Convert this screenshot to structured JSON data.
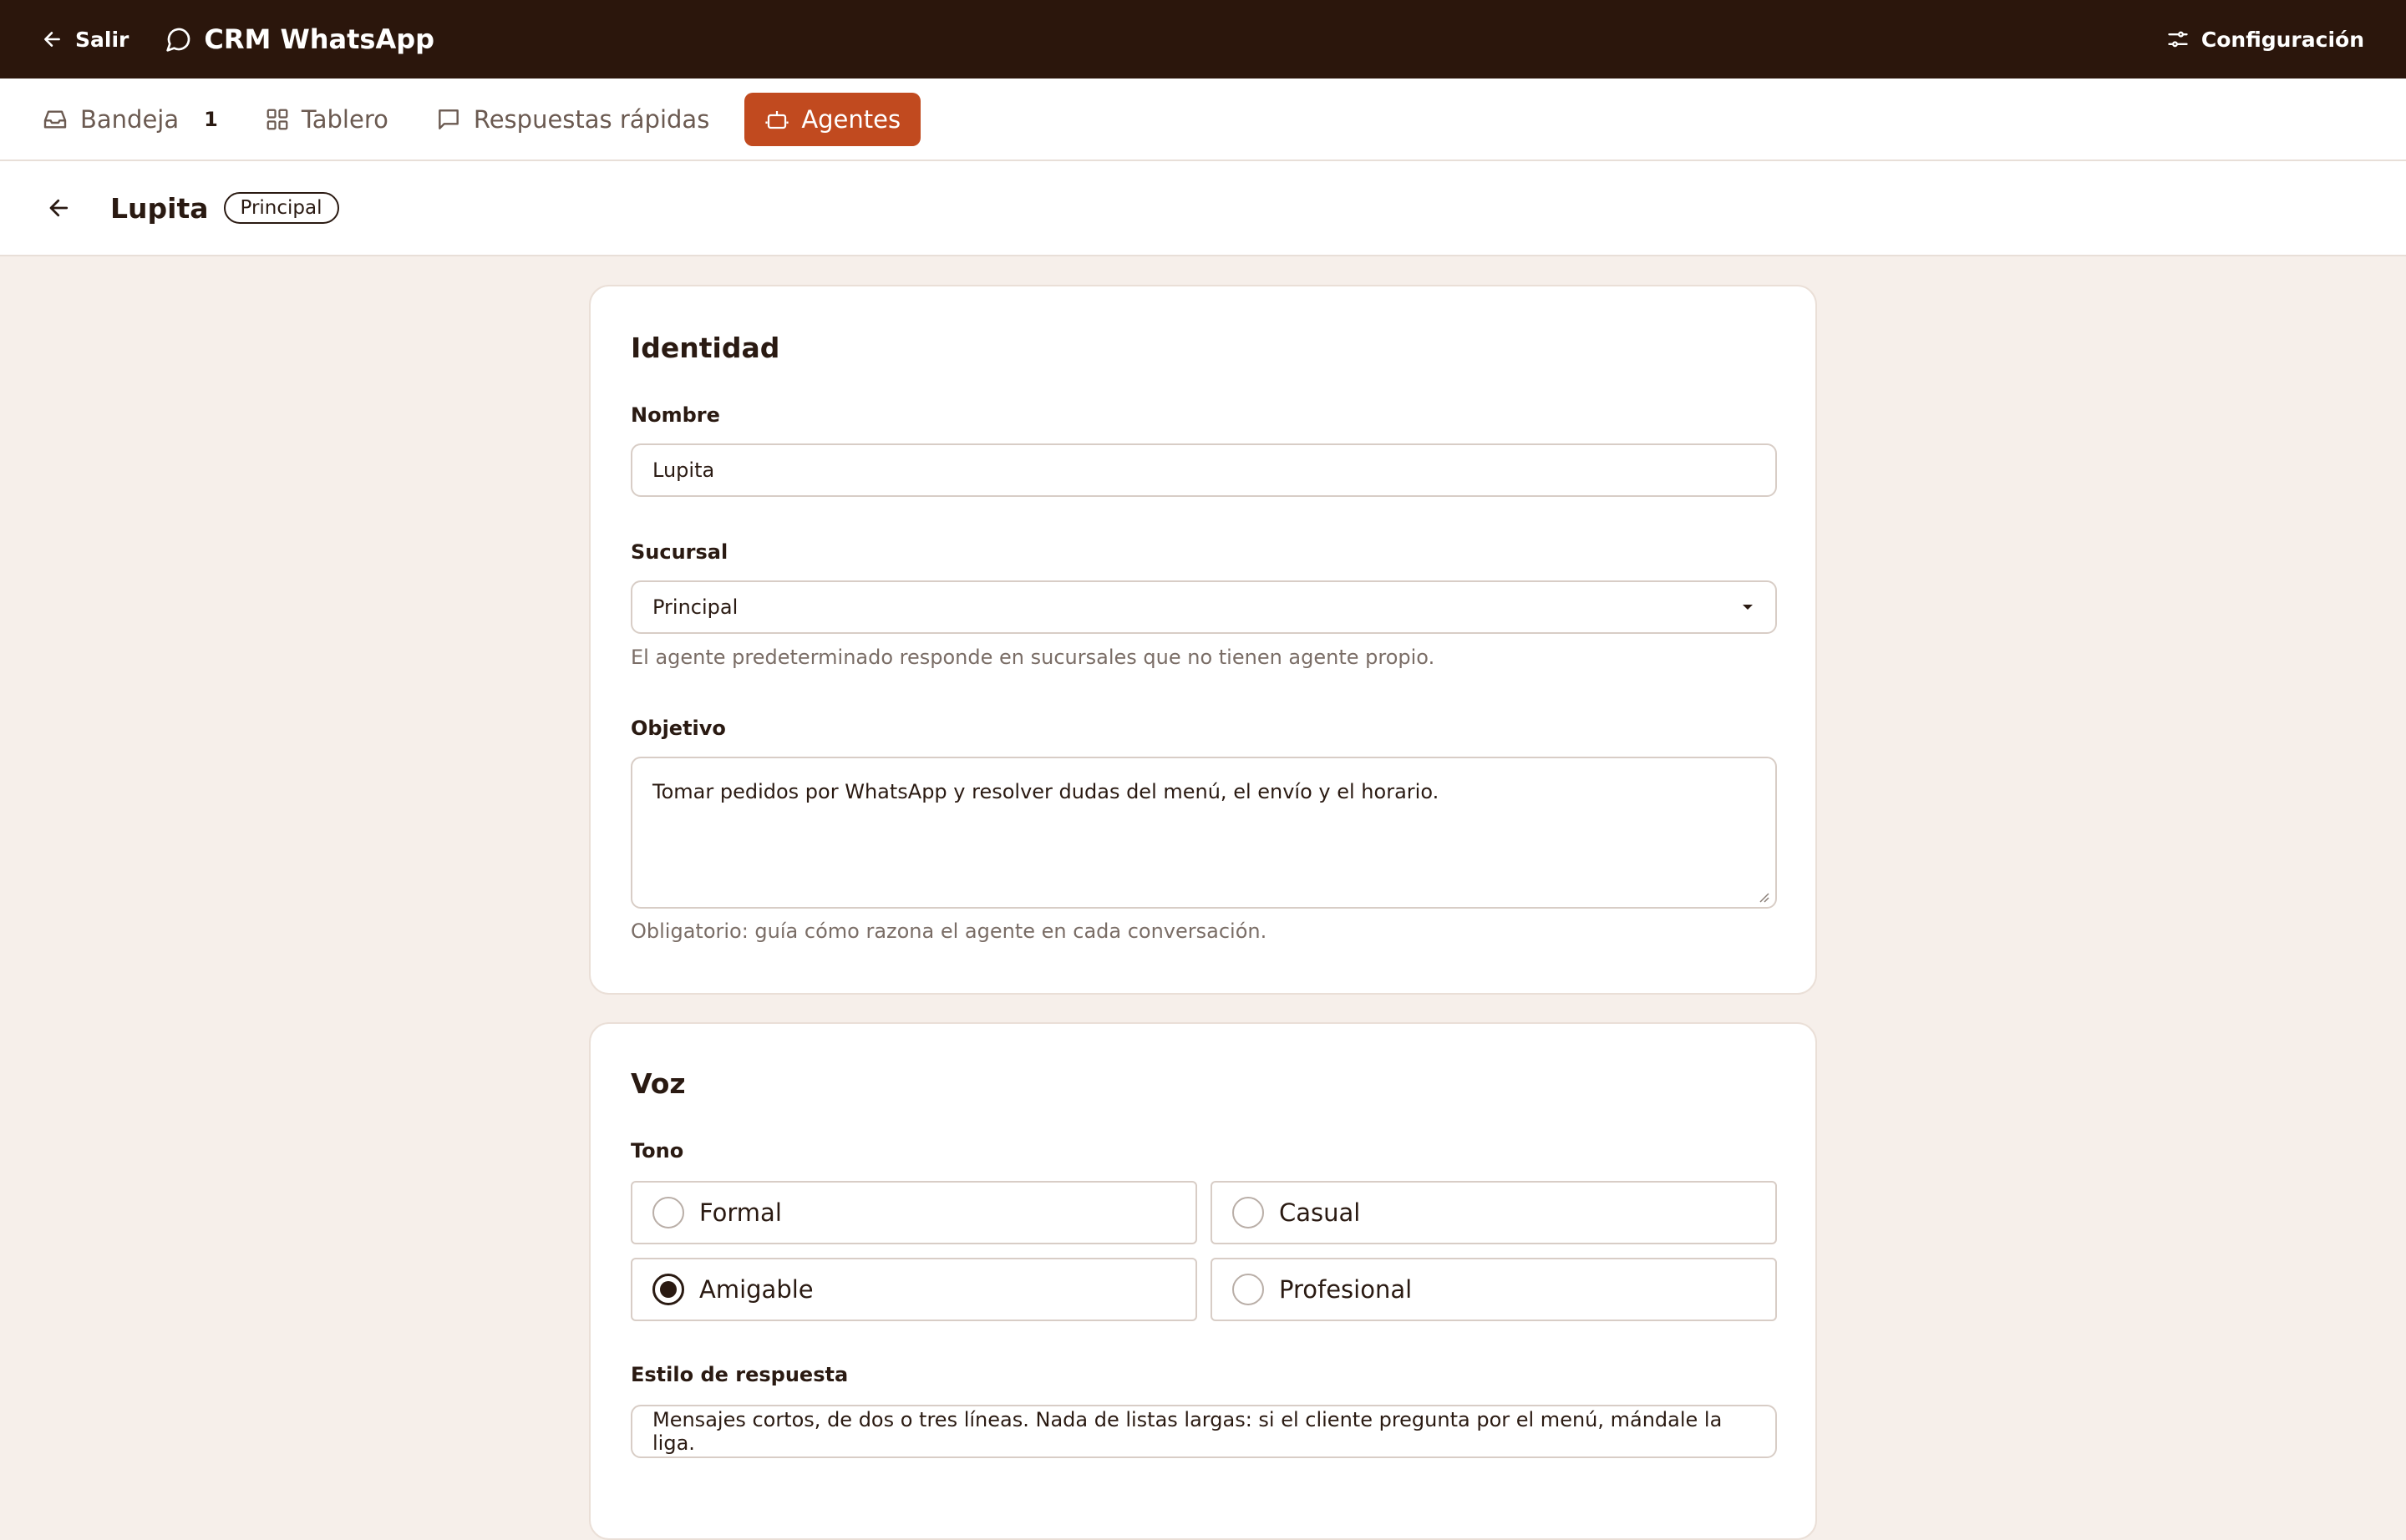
{
  "topbar": {
    "exit_label": "Salir",
    "app_title": "CRM WhatsApp",
    "config_label": "Configuración"
  },
  "tabs": [
    {
      "label": "Bandeja",
      "count": "1",
      "icon": "inbox-icon",
      "active": false
    },
    {
      "label": "Tablero",
      "icon": "grid-icon",
      "active": false
    },
    {
      "label": "Respuestas rápidas",
      "icon": "message-icon",
      "active": false
    },
    {
      "label": "Agentes",
      "icon": "bot-icon",
      "active": true
    }
  ],
  "header": {
    "title": "Lupita",
    "badge": "Principal"
  },
  "identidad": {
    "heading": "Identidad",
    "nombre_label": "Nombre",
    "nombre_value": "Lupita",
    "sucursal_label": "Sucursal",
    "sucursal_value": "Principal",
    "sucursal_hint": "El agente predeterminado responde en sucursales que no tienen agente propio.",
    "objetivo_label": "Objetivo",
    "objetivo_value": "Tomar pedidos por WhatsApp y resolver dudas del menú, el envío y el horario.",
    "objetivo_hint": "Obligatorio: guía cómo razona el agente en cada conversación."
  },
  "voz": {
    "heading": "Voz",
    "tono_label": "Tono",
    "tono_options": [
      {
        "label": "Formal",
        "checked": false
      },
      {
        "label": "Casual",
        "checked": false
      },
      {
        "label": "Amigable",
        "checked": true
      },
      {
        "label": "Profesional",
        "checked": false
      }
    ],
    "estilo_label": "Estilo de respuesta",
    "estilo_value": "Mensajes cortos, de dos o tres líneas. Nada de listas largas: si el cliente pregunta por el menú, mándale la liga."
  },
  "colors": {
    "topbar_bg": "#2b160c",
    "accent": "#c14a1f",
    "page_bg": "#f6efea"
  }
}
